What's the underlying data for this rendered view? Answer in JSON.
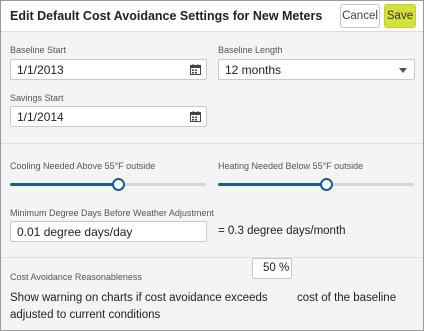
{
  "dialog": {
    "title": "Edit Default Cost Avoidance Settings for New Meters",
    "cancel_label": "Cancel",
    "save_label": "Save",
    "accent_color": "#d4e13a",
    "slider_color": "#1b5e8b"
  },
  "baseline_start": {
    "label": "Baseline Start",
    "value": "1/1/2013",
    "icon": "calendar-icon"
  },
  "baseline_length": {
    "label": "Baseline Length",
    "value": "12 months",
    "icon": "chevron-down-icon"
  },
  "savings_start": {
    "label": "Savings Start",
    "value": "1/1/2014",
    "icon": "calendar-icon"
  },
  "cooling": {
    "label": "Cooling Needed Above 55°F outside",
    "level": 0.55
  },
  "heating": {
    "label": "Heating Needed Below 55°F outside",
    "level": 0.55
  },
  "min_degree_days": {
    "label": "Minimum Degree Days Before Weather Adjustment",
    "value": "0.01 degree days/day",
    "equivalent": "= 0.3 degree days/month"
  },
  "reasonableness": {
    "label": "Cost Avoidance Reasonableness",
    "text_before": "Show warning on charts if cost avoidance exceeds",
    "percent_value": "50 %",
    "text_after": "cost of the baseline",
    "text_line2": "adjusted to current conditions"
  }
}
